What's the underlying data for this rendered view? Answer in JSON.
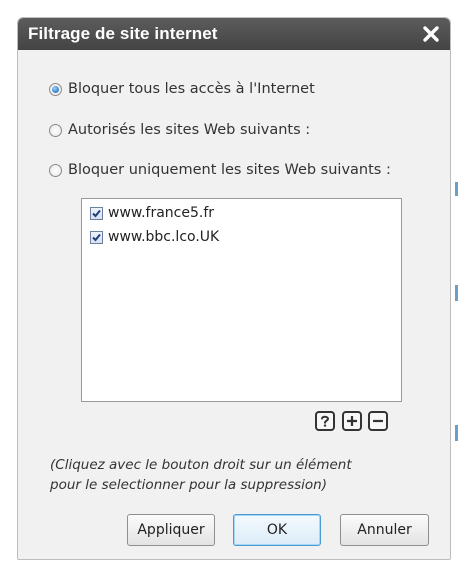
{
  "dialog": {
    "title": "Filtrage de site internet",
    "close_icon": "close-icon"
  },
  "options": [
    {
      "label": "Bloquer tous les accès à l'Internet",
      "selected": true
    },
    {
      "label": "Autorisés les sites Web suivants :",
      "selected": false
    },
    {
      "label": "Bloquer uniquement les sites Web suivants :",
      "selected": false
    }
  ],
  "sites": [
    {
      "label": "www.france5.fr",
      "checked": true
    },
    {
      "label": "www.bbc.lco.UK",
      "checked": true
    }
  ],
  "tools": {
    "help_icon": "help-icon",
    "add_icon": "plus-icon",
    "remove_icon": "minus-icon"
  },
  "hint": {
    "line1": "(Cliquez avec le bouton droit sur un élément",
    "line2": "pour le selectionner pour la suppression)"
  },
  "buttons": {
    "apply": "Appliquer",
    "ok": "OK",
    "cancel": "Annuler"
  },
  "colors": {
    "titlebar": "#4f4f4f",
    "radio_selected": "#2e7fc7",
    "default_button_border": "#4a9ad6"
  }
}
